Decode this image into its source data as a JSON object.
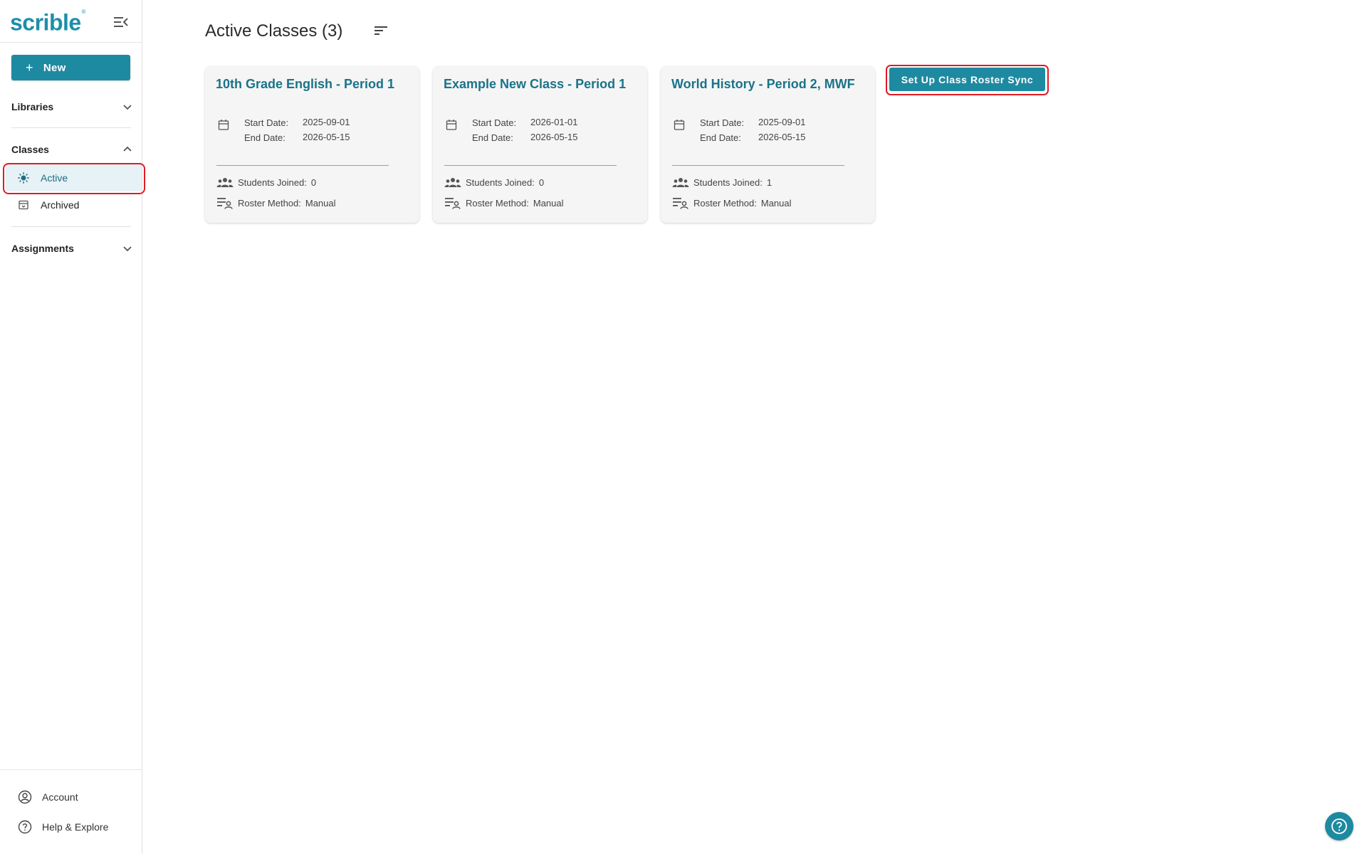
{
  "sidebar": {
    "logo_text": "scrible",
    "logo_mark": "®",
    "collapse_icon": "menu-collapse-icon",
    "new_button": {
      "label": "New",
      "icon": "plus-icon"
    },
    "sections": {
      "libraries": {
        "label": "Libraries",
        "expanded": false
      },
      "classes": {
        "label": "Classes",
        "expanded": true,
        "items": [
          {
            "label": "Active",
            "icon": "sun-icon",
            "selected": true
          },
          {
            "label": "Archived",
            "icon": "archive-box-icon",
            "selected": false
          }
        ]
      },
      "assignments": {
        "label": "Assignments",
        "expanded": false
      }
    },
    "footer": {
      "account": {
        "label": "Account",
        "icon": "account-circle-icon"
      },
      "help": {
        "label": "Help & Explore",
        "icon": "help-circle-icon"
      }
    }
  },
  "main": {
    "title": "Active Classes (3)",
    "sort_icon": "sort-icon",
    "sync_button": "Set Up Class Roster Sync",
    "labels": {
      "start": "Start Date:",
      "end": "End Date:",
      "students": "Students Joined:",
      "roster": "Roster Method:"
    },
    "classes": [
      {
        "title": "10th Grade English - Period 1",
        "start_date": "2025-09-01",
        "end_date": "2026-05-15",
        "students_joined": "0",
        "roster_method": "Manual"
      },
      {
        "title": "Example New Class - Period 1",
        "start_date": "2026-01-01",
        "end_date": "2026-05-15",
        "students_joined": "0",
        "roster_method": "Manual"
      },
      {
        "title": "World History - Period 2, MWF",
        "start_date": "2025-09-01",
        "end_date": "2026-05-15",
        "students_joined": "1",
        "roster_method": "Manual"
      }
    ]
  },
  "help_fab_icon": "help-circle-icon",
  "colors": {
    "brand": "#1e8aa1",
    "title_text": "#1a7389",
    "highlight": "#e01b24",
    "active_bg": "#e7f2f6"
  }
}
